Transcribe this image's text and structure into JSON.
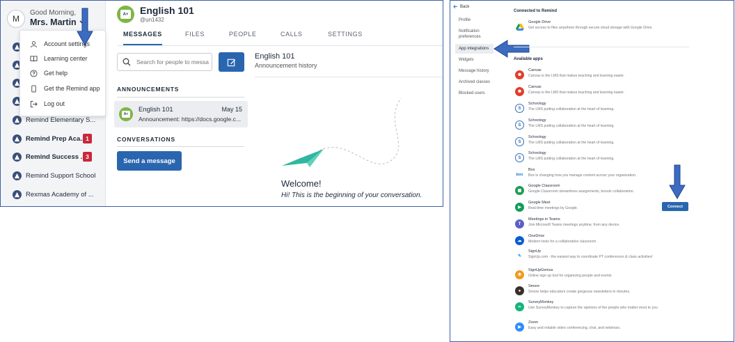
{
  "user": {
    "initial": "M",
    "greeting": "Good Morning,",
    "name": "Mrs. Martin"
  },
  "account_menu": {
    "items": [
      {
        "label": "Account settings",
        "icon": "person-icon"
      },
      {
        "label": "Learning center",
        "icon": "book-icon"
      },
      {
        "label": "Get help",
        "icon": "help-icon"
      },
      {
        "label": "Get the Remind app",
        "icon": "phone-icon"
      },
      {
        "label": "Log out",
        "icon": "logout-icon"
      }
    ]
  },
  "sidebar": {
    "classes": [
      {
        "label": "Remind Elementary S..."
      },
      {
        "label": "Remind Prep Aca...",
        "badge": "1"
      },
      {
        "label": "Remind Success ...",
        "badge": "3"
      },
      {
        "label": "Remind Support School"
      },
      {
        "label": "Rexmas Academy of ..."
      }
    ]
  },
  "class_header": {
    "logo_text": "A+",
    "title": "English 101",
    "code": "@un1432"
  },
  "tabs": [
    "MESSAGES",
    "FILES",
    "PEOPLE",
    "CALLS",
    "SETTINGS"
  ],
  "search": {
    "placeholder": "Search for people to message"
  },
  "sections": {
    "announcements": "ANNOUNCEMENTS",
    "conversations": "CONVERSATIONS"
  },
  "announcement": {
    "title": "English 101",
    "date": "May 15",
    "snippet": "Announcement: https://docs.google.c..."
  },
  "send_message_label": "Send a message",
  "thread": {
    "title": "English 101",
    "subtitle": "Announcement history",
    "welcome": "Welcome!",
    "welcome_sub": "Hi! This is the beginning of your conversation."
  },
  "settings_nav": {
    "back": "Back",
    "items": [
      {
        "label": "Profile"
      },
      {
        "label": "Notification preferences"
      },
      {
        "label": "App integrations"
      },
      {
        "label": "Widgets"
      },
      {
        "label": "Message history"
      },
      {
        "label": "Archived classes"
      },
      {
        "label": "Blocked users"
      }
    ]
  },
  "integrations": {
    "connected_heading": "Connected to Remind",
    "available_heading": "Available apps",
    "connected": [
      {
        "name": "Google Drive",
        "desc": "Get access to files anywhere through secure cloud storage with Google Drive.",
        "icon": "google-drive-icon"
      }
    ],
    "available": [
      {
        "name": "Canvas",
        "desc": "Canvas is the LMS that makes teaching and learning easier.",
        "icon": "canvas-icon",
        "color": "#e13e2b"
      },
      {
        "name": "Canvas",
        "desc": "Canvas is the LMS that makes teaching and learning easier.",
        "icon": "canvas-icon",
        "color": "#e13e2b"
      },
      {
        "name": "Schoology",
        "desc": "The LMS putting collaboration at the heart of learning.",
        "icon": "schoology-icon",
        "color": "#2f6db5"
      },
      {
        "name": "Schoology",
        "desc": "The LMS putting collaboration at the heart of learning.",
        "icon": "schoology-icon",
        "color": "#2f6db5"
      },
      {
        "name": "Schoology",
        "desc": "The LMS putting collaboration at the heart of learning.",
        "icon": "schoology-icon",
        "color": "#2f6db5"
      },
      {
        "name": "Schoology",
        "desc": "The LMS putting collaboration at the heart of learning.",
        "icon": "schoology-icon",
        "color": "#2f6db5"
      },
      {
        "name": "Box",
        "desc": "Box is changing how you manage content across your organization.",
        "icon": "box-icon",
        "color": "#0b6ed2"
      },
      {
        "name": "Google Classroom",
        "desc": "Google Classroom streamlines assignments, boosts collaboration.",
        "icon": "google-classroom-icon",
        "color": "#1f9d55"
      },
      {
        "name": "Google Meet",
        "desc": "Real-time meetings by Google.",
        "icon": "google-meet-icon",
        "color": "#0f9d58"
      },
      {
        "name": "Meetings in Teams",
        "desc": "Join Microsoft Teams meetings anytime, from any device.",
        "icon": "teams-icon",
        "color": "#5b5fc7"
      },
      {
        "name": "OneDrive",
        "desc": "Modern tools for a collaborative classroom",
        "icon": "onedrive-icon",
        "color": "#0a5bd0"
      },
      {
        "name": "SignUp",
        "desc": "SignUp.com - the easiest way to coordinate PT conferences & class activities!",
        "icon": "signup-icon",
        "color": "#2aa6e0"
      },
      {
        "name": "SignUpGenius",
        "desc": "Online sign up tool for organizing people and events",
        "icon": "signupgenius-icon",
        "color": "#f29a1f"
      },
      {
        "name": "Smore",
        "desc": "Smore helps educators create gorgeous newsletters in minutes.",
        "icon": "smore-icon",
        "color": "#3a2e28"
      },
      {
        "name": "SurveyMonkey",
        "desc": "Use SurveyMonkey to capture the opinions of the people who matter most to you",
        "icon": "surveymonkey-icon",
        "color": "#16b37a"
      },
      {
        "name": "Zoom",
        "desc": "Easy and reliable video conferencing, chat, and webinars.",
        "icon": "zoom-icon",
        "color": "#2d8cff"
      }
    ],
    "connect_label": "Connect"
  },
  "colors": {
    "primary": "#2a66b0",
    "badge": "#c8283b",
    "class_logo": "#7eb643",
    "annotation_arrow": "#3c6cc0"
  }
}
